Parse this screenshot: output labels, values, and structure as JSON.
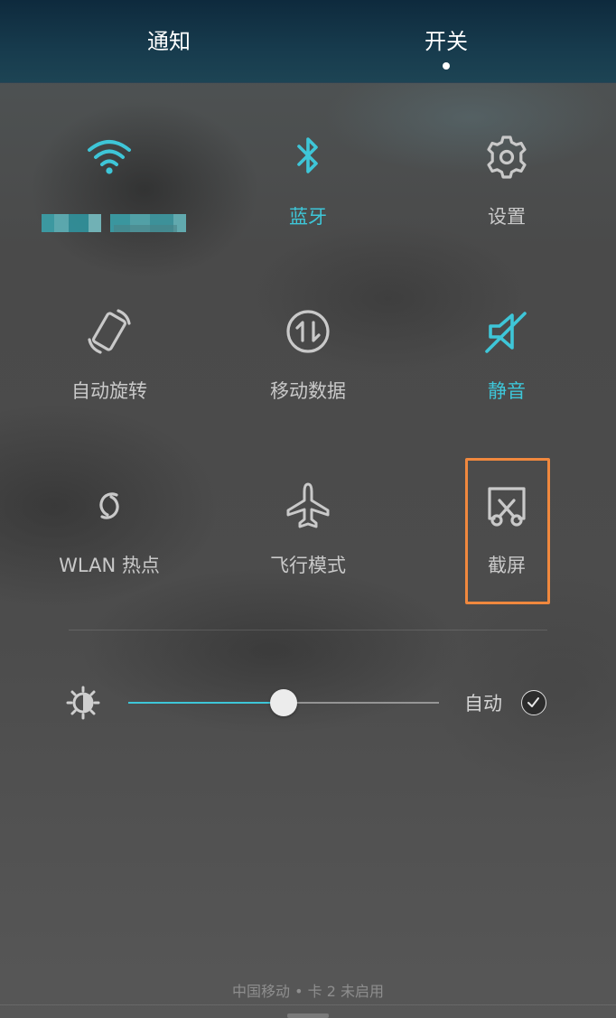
{
  "tabs": {
    "notifications": "通知",
    "toggles": "开关",
    "active_tab": "开关"
  },
  "tiles": [
    {
      "id": "wifi",
      "icon": "wifi-icon",
      "label": "",
      "active": true
    },
    {
      "id": "bluetooth",
      "icon": "bluetooth-icon",
      "label": "蓝牙",
      "active": true
    },
    {
      "id": "settings",
      "icon": "gear-icon",
      "label": "设置",
      "active": false
    },
    {
      "id": "auto-rotate",
      "icon": "rotate-icon",
      "label": "自动旋转",
      "active": false
    },
    {
      "id": "mobile-data",
      "icon": "data-arrows-icon",
      "label": "移动数据",
      "active": false
    },
    {
      "id": "silent",
      "icon": "silent-icon",
      "label": "静音",
      "active": true
    },
    {
      "id": "hotspot",
      "icon": "hotspot-icon",
      "label": "WLAN 热点",
      "active": false
    },
    {
      "id": "airplane",
      "icon": "airplane-icon",
      "label": "飞行模式",
      "active": false
    },
    {
      "id": "screenshot",
      "icon": "screenshot-icon",
      "label": "截屏",
      "active": false,
      "highlighted": true
    }
  ],
  "brightness": {
    "level": 0.5,
    "auto_label": "自动",
    "auto_enabled": true
  },
  "carrier_text": "中国移动 • 卡 2 未启用",
  "colors": {
    "active": "#3ec6d8",
    "inactive": "#c9c9c9",
    "highlight_box": "#f0883e",
    "header": "#173b4d"
  }
}
